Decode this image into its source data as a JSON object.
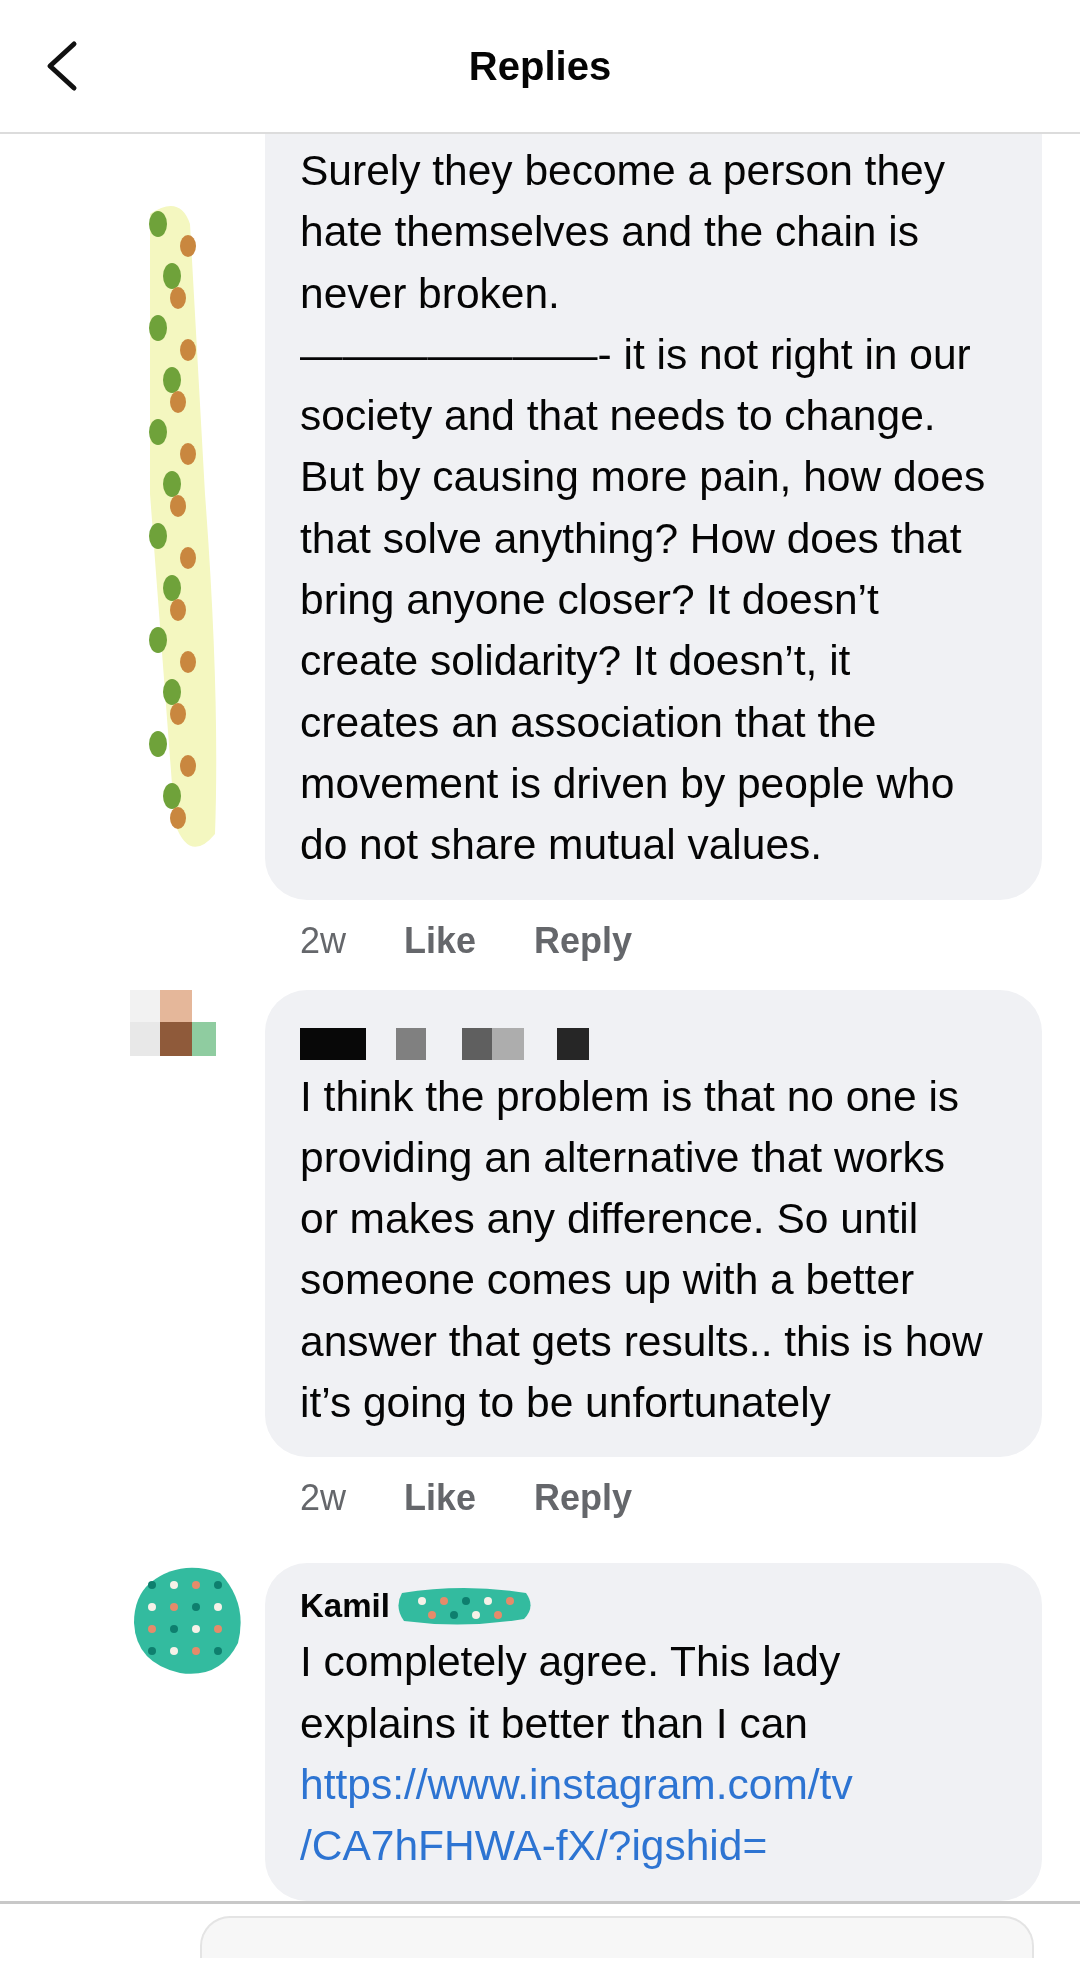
{
  "header": {
    "title": "Replies"
  },
  "comments": [
    {
      "text": "Surely they become a person they hate themselves and the chain is never broken.\n———————- it is not right in our society and that needs to change. But by causing more pain, how does that solve anything? How does that bring anyone closer? It doesn’t create solidarity? It doesn’t, it creates an association that the movement is driven by people who do not share mutual values.",
      "time": "2w",
      "like": "Like",
      "reply": "Reply"
    },
    {
      "text": "I think the problem is that no one is providing an alternative that works or makes any difference. So until someone comes up with a better answer that gets results.. this is how it’s going to be unfortunately",
      "time": "2w",
      "like": "Like",
      "reply": "Reply"
    },
    {
      "name": "Kamil",
      "text": "I completely agree. This lady explains it better than I can",
      "link": "https://www.instagram.com/tv /CA7hFHWA-fX/?igshid="
    }
  ]
}
